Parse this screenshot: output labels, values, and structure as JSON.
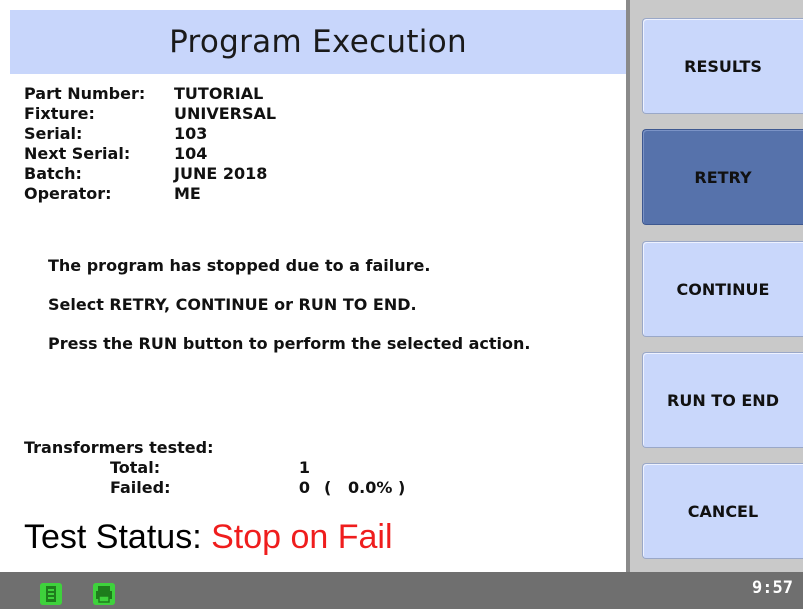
{
  "header": {
    "title": "Program Execution"
  },
  "info": [
    {
      "key": "Part Number:",
      "value": "TUTORIAL"
    },
    {
      "key": "Fixture:",
      "value": "UNIVERSAL"
    },
    {
      "key": "Serial:",
      "value": "103"
    },
    {
      "key": "Next Serial:",
      "value": "104"
    },
    {
      "key": "Batch:",
      "value": "JUNE 2018"
    },
    {
      "key": "Operator:",
      "value": "ME"
    }
  ],
  "messages": [
    "The program has stopped due to a failure.",
    "Select RETRY, CONTINUE or RUN TO END.",
    "Press the RUN button to perform the selected action."
  ],
  "tested": {
    "heading": "Transformers tested:",
    "total_label": "Total:",
    "total_value": "1",
    "failed_label": "Failed:",
    "failed_value": "0",
    "failed_percent": "(   0.0% )"
  },
  "status": {
    "label": "Test Status:",
    "value": "Stop on Fail"
  },
  "side_buttons": [
    {
      "label": "RESULTS",
      "active": false
    },
    {
      "label": "RETRY",
      "active": true
    },
    {
      "label": "CONTINUE",
      "active": false
    },
    {
      "label": "RUN TO END",
      "active": false
    },
    {
      "label": "CANCEL",
      "active": false
    }
  ],
  "statusbar": {
    "clock": "9:57",
    "icons": [
      "list-icon",
      "printer-icon"
    ]
  },
  "colors": {
    "title_bg": "#c8d6fb",
    "button_bg": "#c9d7fb",
    "button_active": "#5672ab",
    "status_fail": "#ef1d1d",
    "icon_green": "#3ed23c"
  }
}
